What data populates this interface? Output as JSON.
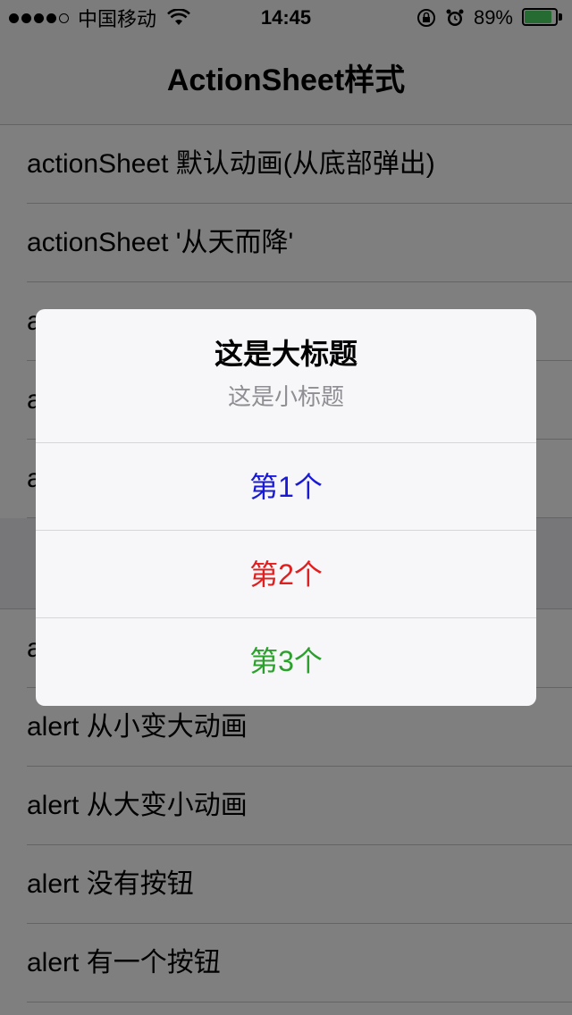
{
  "status_bar": {
    "carrier": "中国移动",
    "time": "14:45",
    "battery": "89%",
    "battery_level": 0.89,
    "signal_bars_filled": 4,
    "signal_bars_total": 5
  },
  "nav": {
    "title": "ActionSheet样式"
  },
  "list": {
    "group1": [
      {
        "label": "actionSheet 默认动画(从底部弹出)"
      },
      {
        "label": "actionSheet '从天而降'"
      },
      {
        "label": "a"
      },
      {
        "label": "a"
      },
      {
        "label": "a"
      }
    ],
    "group2": [
      {
        "label": "a"
      },
      {
        "label": "alert 从小变大动画"
      },
      {
        "label": "alert 从大变小动画"
      },
      {
        "label": "alert 没有按钮"
      },
      {
        "label": "alert 有一个按钮"
      }
    ]
  },
  "alert": {
    "title": "这是大标题",
    "subtitle": "这是小标题",
    "buttons": [
      {
        "label": "第1个",
        "color": "#1a1ad6"
      },
      {
        "label": "第2个",
        "color": "#e02020"
      },
      {
        "label": "第3个",
        "color": "#2ca02c"
      }
    ]
  },
  "colors": {
    "overlay": "rgba(0,0,0,0.5)",
    "battery_fill": "#4cd964"
  }
}
